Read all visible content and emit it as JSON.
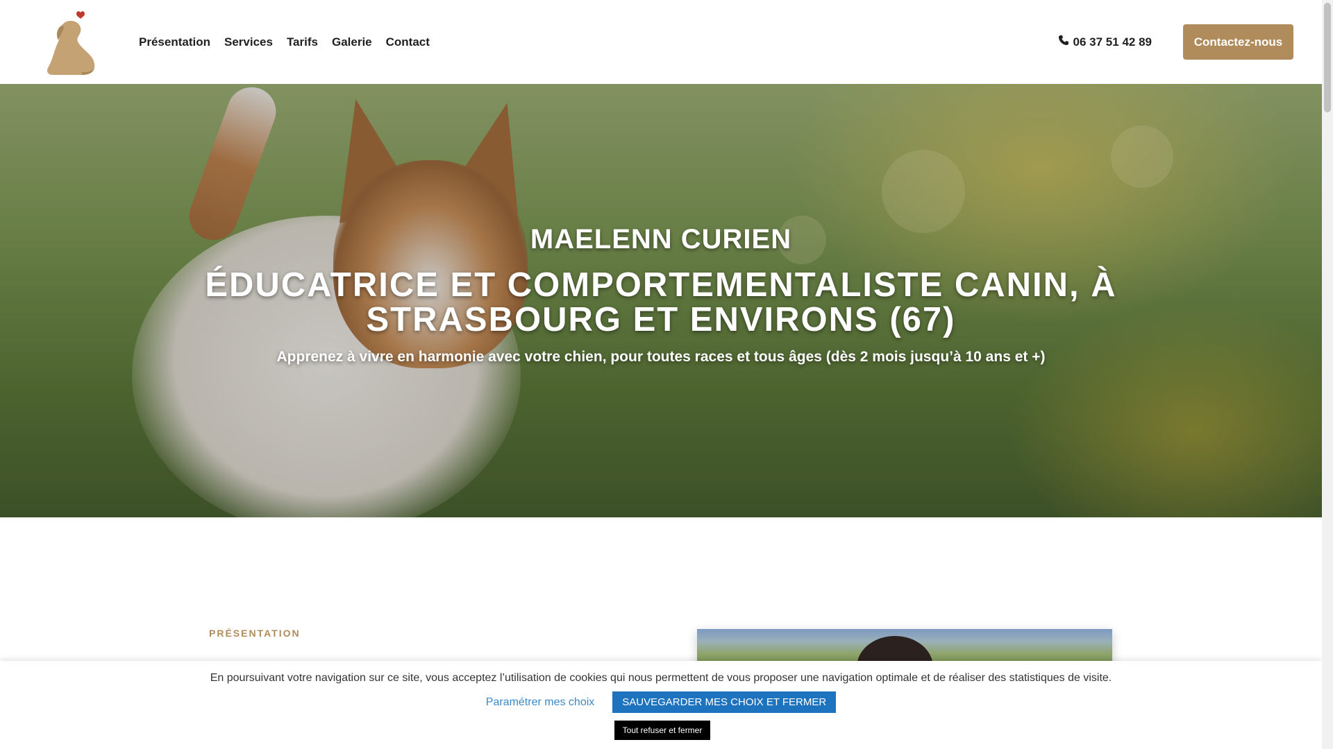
{
  "header": {
    "logo_alt": "dog-logo",
    "nav": [
      {
        "label": "Présentation"
      },
      {
        "label": "Services"
      },
      {
        "label": "Tarifs"
      },
      {
        "label": "Galerie"
      },
      {
        "label": "Contact"
      }
    ],
    "phone": "06 37 51 42 89",
    "cta_label": "Contactez-nous"
  },
  "hero": {
    "name": "MAELENN CURIEN",
    "title": "ÉDUCATRICE ET COMPORTEMENTALISTE CANIN, À STRASBOURG ET ENVIRONS (67)",
    "subtitle": "Apprenez à vivre en harmonie avec votre chien, pour toutes races et tous âges (dès 2 mois jusqu’à 10 ans et +)"
  },
  "presentation": {
    "label": "PRÉSENTATION"
  },
  "cookie": {
    "text": "En poursuivant votre navigation sur ce site, vous acceptez l’utilisation de cookies qui nous permettent de vous proposer une navigation optimale et de réaliser des statistiques de visite.",
    "settings_label": "Paramétrer mes choix",
    "save_label": "SAUVEGARDER MES CHOIX ET FERMER",
    "refuse_label": "Tout refuser et fermer"
  },
  "colors": {
    "brand": "#b08b5b",
    "cookie_button": "#1e73be",
    "cookie_link": "#3c89c9"
  }
}
